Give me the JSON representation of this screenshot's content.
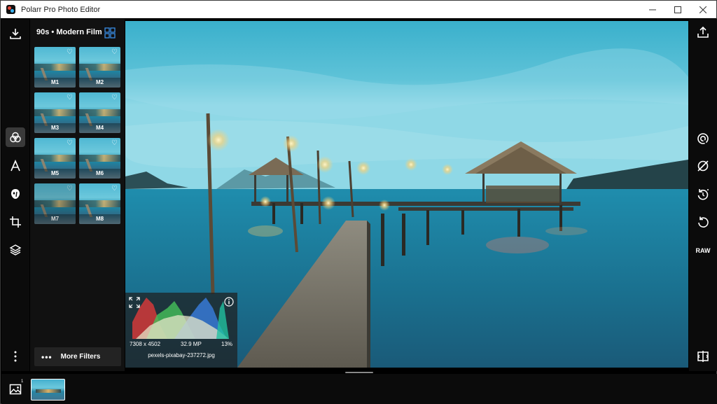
{
  "app": {
    "title": "Polarr Pro Photo Editor"
  },
  "filter_panel": {
    "title": "90s • Modern Film",
    "filters": [
      {
        "label": "M1"
      },
      {
        "label": "M2"
      },
      {
        "label": "M3"
      },
      {
        "label": "M4"
      },
      {
        "label": "M5"
      },
      {
        "label": "M6"
      },
      {
        "label": "M7"
      },
      {
        "label": "M8"
      }
    ],
    "more_label": "More Filters"
  },
  "left_tools": [
    "download-icon",
    "filters-icon",
    "text-icon",
    "face-icon",
    "crop-icon",
    "layers-icon",
    "more-vertical-icon"
  ],
  "right_tools": [
    "share-icon",
    "auto-enhance-icon",
    "hide-adjustments-icon",
    "history-icon",
    "reset-icon",
    "raw-icon",
    "compare-icon"
  ],
  "right_tools_labels": {
    "raw": "RAW"
  },
  "histogram": {
    "dimensions": "7308 x 4502",
    "megapixels": "32.9 MP",
    "zoom": "13%",
    "filename": "pexels-pixabay-237272.jpg"
  },
  "gallery": {
    "count": "1"
  },
  "colors": {
    "accent": "#3a8ee6",
    "panel": "#111111",
    "toolbar": "#0b0b0b"
  }
}
